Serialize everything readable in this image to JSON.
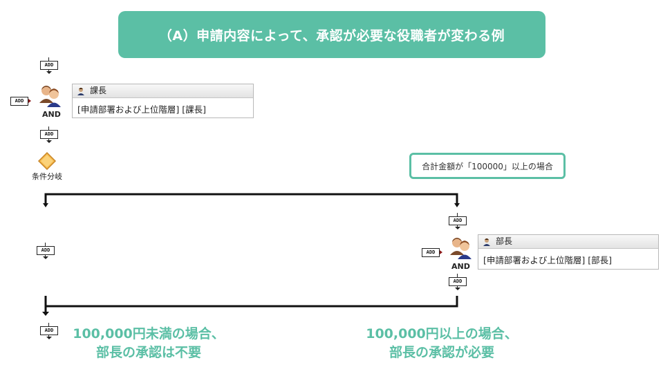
{
  "title": "（A）申請内容によって、承認が必要な役職者が変わる例",
  "add_label": "ADD",
  "and_label": "AND",
  "node1": {
    "title": "課長",
    "body": "[申請部署および上位階層] [課長]"
  },
  "branch": {
    "label": "条件分岐"
  },
  "condition": {
    "text": "合計金額が「100000」以上の場合"
  },
  "node2": {
    "title": "部長",
    "body": "[申請部署および上位階層] [部長]"
  },
  "captions": {
    "left_line1": "100,000円未満の場合、",
    "left_line2": "部長の承認は不要",
    "right_line1": "100,000円以上の場合、",
    "right_line2": "部長の承認が必要"
  },
  "colors": {
    "accent": "#5bbfa5",
    "line": "#111111"
  },
  "icons": [
    "approver-group-icon",
    "person-icon",
    "condition-diamond-icon"
  ]
}
